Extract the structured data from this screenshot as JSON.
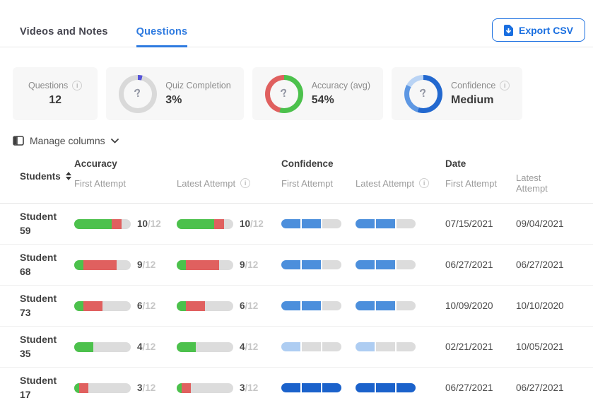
{
  "tabs": [
    {
      "label": "Videos and Notes",
      "active": false
    },
    {
      "label": "Questions",
      "active": true
    }
  ],
  "export_button": {
    "label": "Export CSV",
    "accent_color": "#1a6fe0"
  },
  "stats": {
    "questions": {
      "label": "Questions",
      "value": "12"
    },
    "quiz_completion": {
      "label": "Quiz Completion",
      "value": "3%",
      "donut": {
        "track": "#d9d9d9",
        "segments": [
          {
            "color": "#5553d8",
            "pct": 4
          }
        ]
      }
    },
    "accuracy": {
      "label": "Accuracy (avg)",
      "value": "54%",
      "donut": {
        "track": "#d9d9d9",
        "segments": [
          {
            "color": "#4cc14c",
            "pct": 54
          },
          {
            "color": "#e0605f",
            "pct": 46
          }
        ]
      }
    },
    "confidence": {
      "label": "Confidence",
      "value": "Medium",
      "donut": {
        "track": "#d9d9d9",
        "segments": [
          {
            "color": "#2268cf",
            "pct": 55
          },
          {
            "color": "#5d97e3",
            "pct": 28
          },
          {
            "color": "#b9d3f4",
            "pct": 17
          }
        ]
      }
    }
  },
  "manage_columns": {
    "label": "Manage columns"
  },
  "table": {
    "header": {
      "students": "Students",
      "accuracy": "Accuracy",
      "confidence": "Confidence",
      "date": "Date",
      "first_attempt": "First Attempt",
      "latest_attempt": "Latest Attempt"
    },
    "bar_colors": {
      "correct": "#4cc14c",
      "incorrect": "#e0605f",
      "empty": "#dcdcdc"
    },
    "confidence_levels": {
      "low": {
        "filled": 1,
        "color": "#aecdf2"
      },
      "medium": {
        "filled": 2,
        "color": "#4c8fdc"
      },
      "high": {
        "filled": 3,
        "color": "#1b62cb"
      }
    },
    "rows": [
      {
        "student": "Student 59",
        "accuracy_first": {
          "correct": 8,
          "incorrect": 2,
          "total": 12,
          "score": "10"
        },
        "accuracy_latest": {
          "correct": 8,
          "incorrect": 2,
          "total": 12,
          "score": "10"
        },
        "confidence_first": "medium",
        "confidence_latest": "medium",
        "date_first": "07/15/2021",
        "date_latest": "09/04/2021"
      },
      {
        "student": "Student 68",
        "accuracy_first": {
          "correct": 2,
          "incorrect": 7,
          "total": 12,
          "score": "9"
        },
        "accuracy_latest": {
          "correct": 2,
          "incorrect": 7,
          "total": 12,
          "score": "9"
        },
        "confidence_first": "medium",
        "confidence_latest": "medium",
        "date_first": "06/27/2021",
        "date_latest": "06/27/2021"
      },
      {
        "student": "Student 73",
        "accuracy_first": {
          "correct": 2,
          "incorrect": 4,
          "total": 12,
          "score": "6"
        },
        "accuracy_latest": {
          "correct": 2,
          "incorrect": 4,
          "total": 12,
          "score": "6"
        },
        "confidence_first": "medium",
        "confidence_latest": "medium",
        "date_first": "10/09/2020",
        "date_latest": "10/10/2020"
      },
      {
        "student": "Student 35",
        "accuracy_first": {
          "correct": 4,
          "incorrect": 0,
          "total": 12,
          "score": "4"
        },
        "accuracy_latest": {
          "correct": 4,
          "incorrect": 0,
          "total": 12,
          "score": "4"
        },
        "confidence_first": "low",
        "confidence_latest": "low",
        "date_first": "02/21/2021",
        "date_latest": "10/05/2021"
      },
      {
        "student": "Student 17",
        "accuracy_first": {
          "correct": 1,
          "incorrect": 2,
          "total": 12,
          "score": "3"
        },
        "accuracy_latest": {
          "correct": 1,
          "incorrect": 2,
          "total": 12,
          "score": "3"
        },
        "confidence_first": "high",
        "confidence_latest": "high",
        "date_first": "06/27/2021",
        "date_latest": "06/27/2021"
      }
    ]
  }
}
